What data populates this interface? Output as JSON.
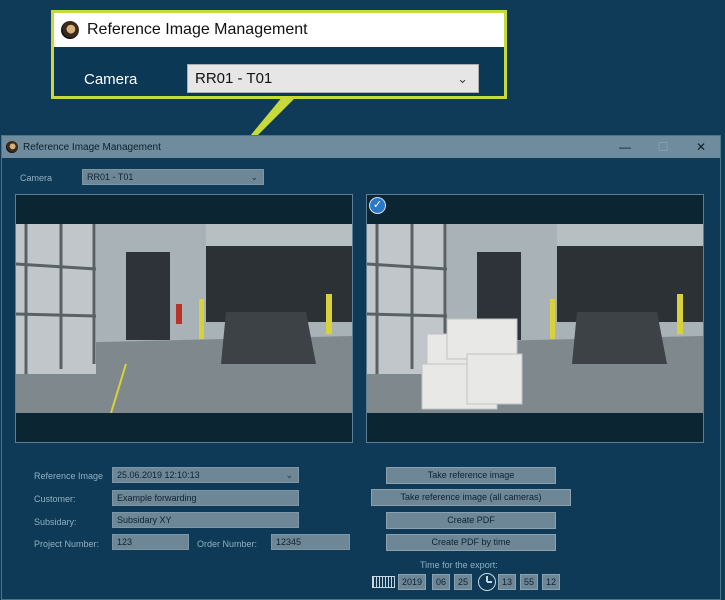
{
  "callout": {
    "title": "Reference Image Management",
    "camera_label": "Camera",
    "camera_value": "RR01 - T01",
    "logo_icon": "app-logo-icon",
    "highlight_color": "#c8d93a"
  },
  "window": {
    "title": "Reference Image Management",
    "controls": {
      "minimize": "—",
      "maximize": "☐",
      "close": "✕"
    },
    "camera_label": "Camera",
    "camera_value": "RR01 - T01",
    "reference_image_label": "Reference Image",
    "reference_image_value": "25.06.2019 12:10:13",
    "customer_label": "Customer:",
    "customer_value": "Example forwarding",
    "subsidiary_label": "Subsidary:",
    "subsidiary_value": "Subsidary XY",
    "project_label": "Project Number:",
    "project_value": "123",
    "order_label": "Order Number:",
    "order_value": "12345",
    "buttons": {
      "take_reference": "Take reference image",
      "take_reference_all": "Take reference image (all cameras)",
      "create_pdf": "Create PDF",
      "create_pdf_time": "Create PDF by time"
    },
    "export": {
      "label": "Time for the export:",
      "year": "2019",
      "month": "06",
      "day": "25",
      "hour": "13",
      "minute": "55",
      "second": "12"
    },
    "panels": {
      "left": "live-camera-view",
      "right": "reference-image-view",
      "right_badge_icon": "checkmark-icon"
    }
  }
}
